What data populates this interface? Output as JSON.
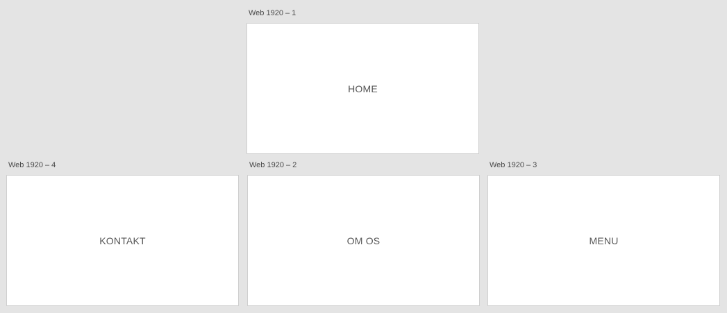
{
  "artboards": [
    {
      "label": "Web 1920 – 1",
      "content": "HOME"
    },
    {
      "label": "Web 1920 – 2",
      "content": "OM OS"
    },
    {
      "label": "Web 1920 – 3",
      "content": "MENU"
    },
    {
      "label": "Web 1920 – 4",
      "content": "KONTAKT"
    }
  ],
  "colors": {
    "canvas_background": "#e4e4e4",
    "artboard_background": "#ffffff",
    "artboard_border": "#cfcfcf",
    "label_text": "#4a4a4a",
    "content_text": "#555555"
  }
}
